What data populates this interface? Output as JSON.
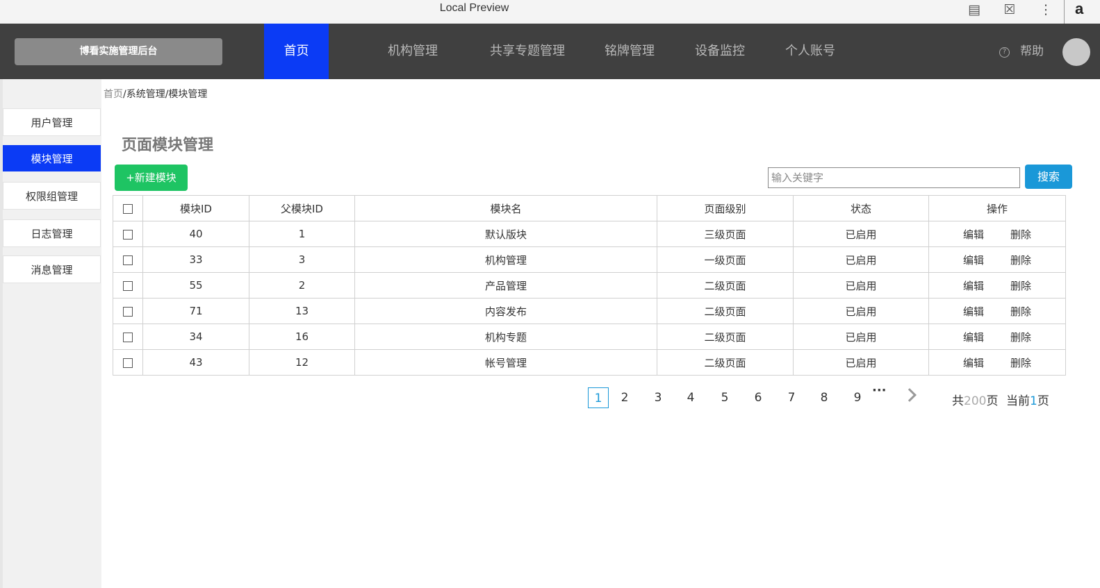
{
  "window": {
    "title": "Local Preview"
  },
  "header": {
    "brand": "博看实施管理后台",
    "nav": [
      {
        "label": "首页",
        "active": true
      },
      {
        "label": "机构管理",
        "active": false
      },
      {
        "label": "共享专题管理",
        "active": false
      },
      {
        "label": "铭牌管理",
        "active": false
      },
      {
        "label": "设备监控",
        "active": false
      },
      {
        "label": "个人账号",
        "active": false
      }
    ],
    "help_label": "帮助"
  },
  "sidebar": {
    "items": [
      {
        "label": "用户管理",
        "active": false
      },
      {
        "label": "模块管理",
        "active": true
      },
      {
        "label": "权限组管理",
        "active": false
      },
      {
        "label": "日志管理",
        "active": false
      },
      {
        "label": "消息管理",
        "active": false
      }
    ]
  },
  "breadcrumb": {
    "home": "首页",
    "rest": "/系统管理/模块管理"
  },
  "page": {
    "title": "页面模块管理"
  },
  "toolbar": {
    "add_label": "+新建模块",
    "search_placeholder": "输入关键字",
    "search_label": "搜索"
  },
  "table": {
    "headers": [
      "模块ID",
      "父模块ID",
      "模块名",
      "页面级别",
      "状态",
      "操作"
    ],
    "rows": [
      {
        "id": "40",
        "parent": "1",
        "name": "默认版块",
        "level": "三级页面",
        "level_color": "#ec6e00",
        "status": "已启用"
      },
      {
        "id": "33",
        "parent": "3",
        "name": "机构管理",
        "level": "一级页面",
        "level_color": "#1ec463",
        "status": "已启用"
      },
      {
        "id": "55",
        "parent": "2",
        "name": "产品管理",
        "level": "二级页面",
        "level_color": "#1a98d8",
        "status": "已启用"
      },
      {
        "id": "71",
        "parent": "13",
        "name": "内容发布",
        "level": "二级页面",
        "level_color": "#1a98d8",
        "status": "已启用"
      },
      {
        "id": "34",
        "parent": "16",
        "name": "机构专题",
        "level": "二级页面",
        "level_color": "#1a98d8",
        "status": "已启用"
      },
      {
        "id": "43",
        "parent": "12",
        "name": "帐号管理",
        "level": "二级页面",
        "level_color": "#1a98d8",
        "status": "已启用"
      }
    ],
    "actions": {
      "edit": "编辑",
      "delete": "删除"
    }
  },
  "pagination": {
    "pages": [
      "1",
      "2",
      "3",
      "4",
      "5",
      "6",
      "7",
      "8",
      "9"
    ],
    "current": "1",
    "ellipsis": "···",
    "total_prefix": "共",
    "total_pages": "200",
    "total_suffix": "页",
    "current_prefix": "当前",
    "current_page": "1",
    "current_suffix": "页"
  },
  "colors": {
    "nav_active": "#0b3bf5",
    "nav_bg": "#404040",
    "add_button": "#1ec463",
    "search_button": "#1a98d8",
    "status_enabled": "#1aa33d"
  },
  "icons": [
    "reader-icon",
    "translate-icon",
    "more-vert-icon",
    "help-icon",
    "avatar",
    "chevron-right-icon"
  ]
}
